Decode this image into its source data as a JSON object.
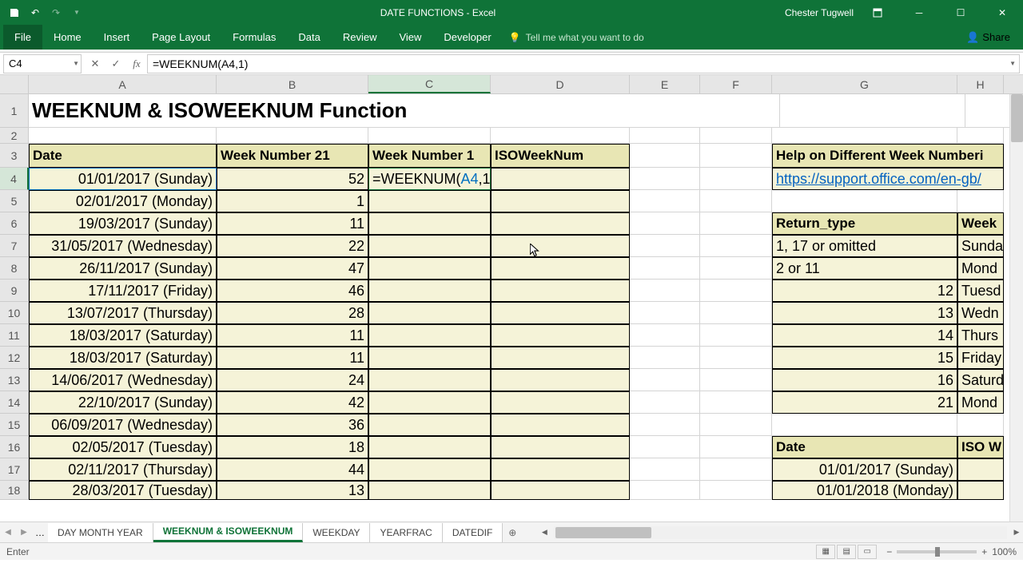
{
  "app": {
    "title": "DATE FUNCTIONS - Excel",
    "user": "Chester Tugwell"
  },
  "ribbon": {
    "tabs": [
      "File",
      "Home",
      "Insert",
      "Page Layout",
      "Formulas",
      "Data",
      "Review",
      "View",
      "Developer"
    ],
    "tellme": "Tell me what you want to do",
    "share": "Share"
  },
  "formula": {
    "cellref": "C4",
    "value": "=WEEKNUM(A4,1)"
  },
  "sheet": {
    "title": "WEEKNUM & ISOWEEKNUM Function",
    "headers": {
      "A": "Date",
      "B": "Week Number 21",
      "C": "Week Number 1",
      "D": "ISOWeekNum"
    },
    "rows": [
      {
        "A": "01/01/2017 (Sunday)",
        "B": "52"
      },
      {
        "A": "02/01/2017 (Monday)",
        "B": "1"
      },
      {
        "A": "19/03/2017 (Sunday)",
        "B": "11"
      },
      {
        "A": "31/05/2017 (Wednesday)",
        "B": "22"
      },
      {
        "A": "26/11/2017 (Sunday)",
        "B": "47"
      },
      {
        "A": "17/11/2017 (Friday)",
        "B": "46"
      },
      {
        "A": "13/07/2017 (Thursday)",
        "B": "28"
      },
      {
        "A": "18/03/2017 (Saturday)",
        "B": "11"
      },
      {
        "A": "18/03/2017 (Saturday)",
        "B": "11"
      },
      {
        "A": "14/06/2017 (Wednesday)",
        "B": "24"
      },
      {
        "A": "22/10/2017 (Sunday)",
        "B": "42"
      },
      {
        "A": "06/09/2017 (Wednesday)",
        "B": "36"
      },
      {
        "A": "02/05/2017 (Tuesday)",
        "B": "18"
      },
      {
        "A": "02/11/2017 (Thursday)",
        "B": "44"
      },
      {
        "A": "28/03/2017 (Tuesday)",
        "B": "13"
      }
    ],
    "activeFormulaDisplay": {
      "pre": "=WEEKNUM(",
      "ref": "A4",
      "post": ",1)"
    },
    "help": {
      "title": "Help on Different Week Numberi",
      "link": "https://support.office.com/en-gb/",
      "rt_hdr": "Return_type",
      "wk_hdr": "Week",
      "rows": [
        {
          "rt": "1, 17 or omitted",
          "wk": "Sunda"
        },
        {
          "rt": "2 or 11",
          "wk": "Mond"
        },
        {
          "rt": "12",
          "wk": "Tuesd"
        },
        {
          "rt": "13",
          "wk": "Wedn"
        },
        {
          "rt": "14",
          "wk": "Thurs"
        },
        {
          "rt": "15",
          "wk": "Friday"
        },
        {
          "rt": "16",
          "wk": "Saturd"
        },
        {
          "rt": "21",
          "wk": "Mond"
        }
      ],
      "date_hdr": "Date",
      "iso_hdr": "ISO W",
      "dates": [
        "01/01/2017 (Sunday)",
        "01/01/2018 (Monday)"
      ]
    }
  },
  "cellEdit": {
    "text": "=WEEKNUM(A4,1)"
  },
  "tabs": [
    "DAY MONTH YEAR",
    "WEEKNUM & ISOWEEKNUM",
    "WEEKDAY",
    "YEARFRAC",
    "DATEDIF"
  ],
  "activeTab": 1,
  "status": {
    "mode": "Enter",
    "zoom": "100%"
  }
}
